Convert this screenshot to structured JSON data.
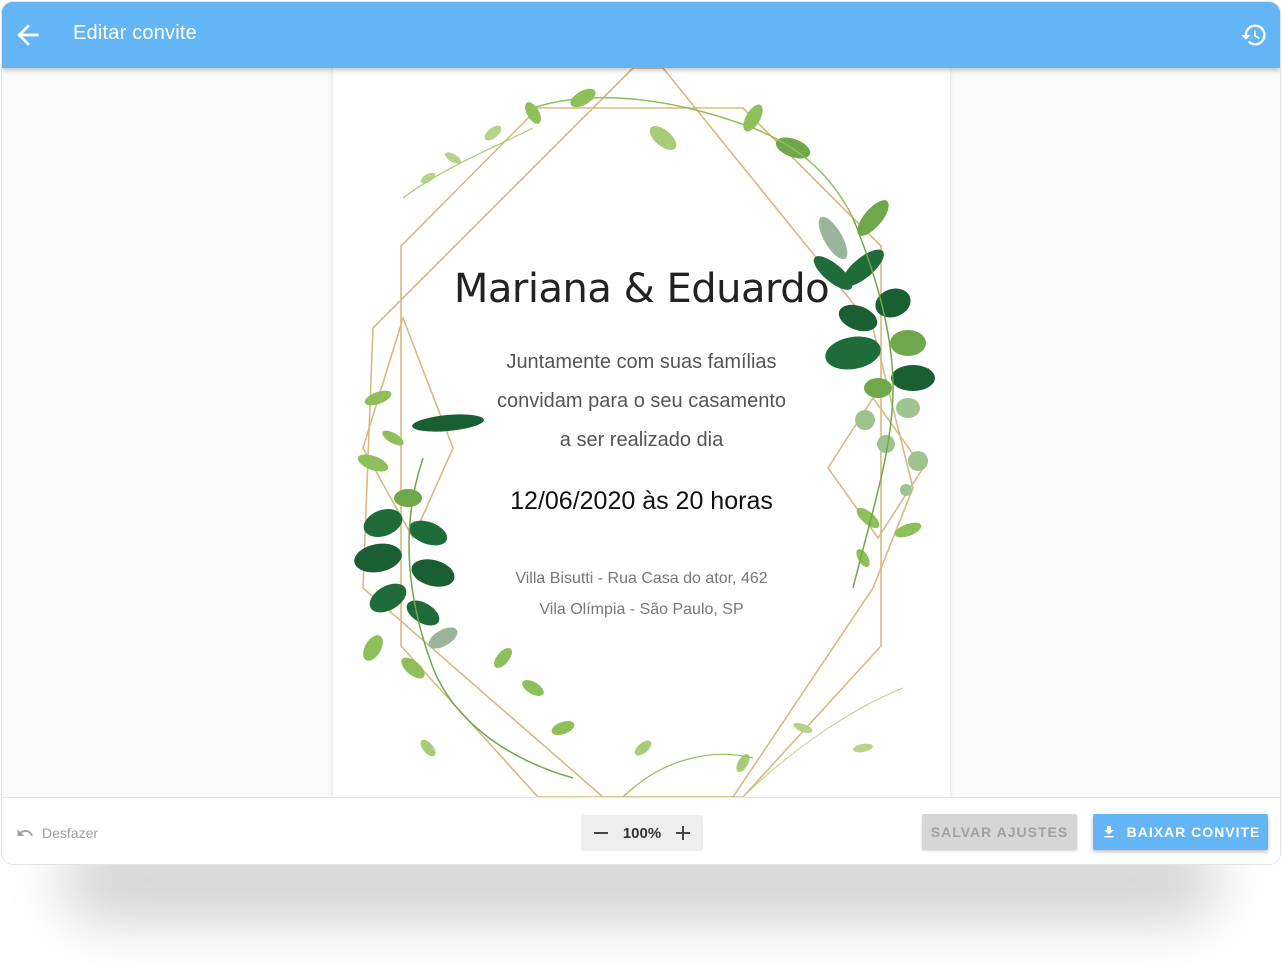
{
  "appbar": {
    "title": "Editar convite",
    "back_icon": "arrow-back-icon",
    "history_icon": "history-icon",
    "color": "#64b5f6"
  },
  "invitation": {
    "names": "Mariana & Eduardo",
    "intro_lines": [
      "Juntamente com suas famílias",
      "convidam para o seu casamento",
      "a ser realizado dia"
    ],
    "datetime": "12/06/2020 às 20 horas",
    "address_lines": [
      "Villa Bisutti - Rua Casa do ator, 462",
      "Vila Olímpia - São Paulo, SP"
    ]
  },
  "toolbar": {
    "undo_label": "Desfazer",
    "zoom_value": "100%",
    "save_label": "SALVAR AJUSTES",
    "download_label": "BAIXAR CONVITE"
  },
  "colors": {
    "accent": "#64b5f6",
    "gold": "#d9b882",
    "leaf_dark": "#1f6b3a",
    "leaf_light": "#8fbf5a"
  }
}
